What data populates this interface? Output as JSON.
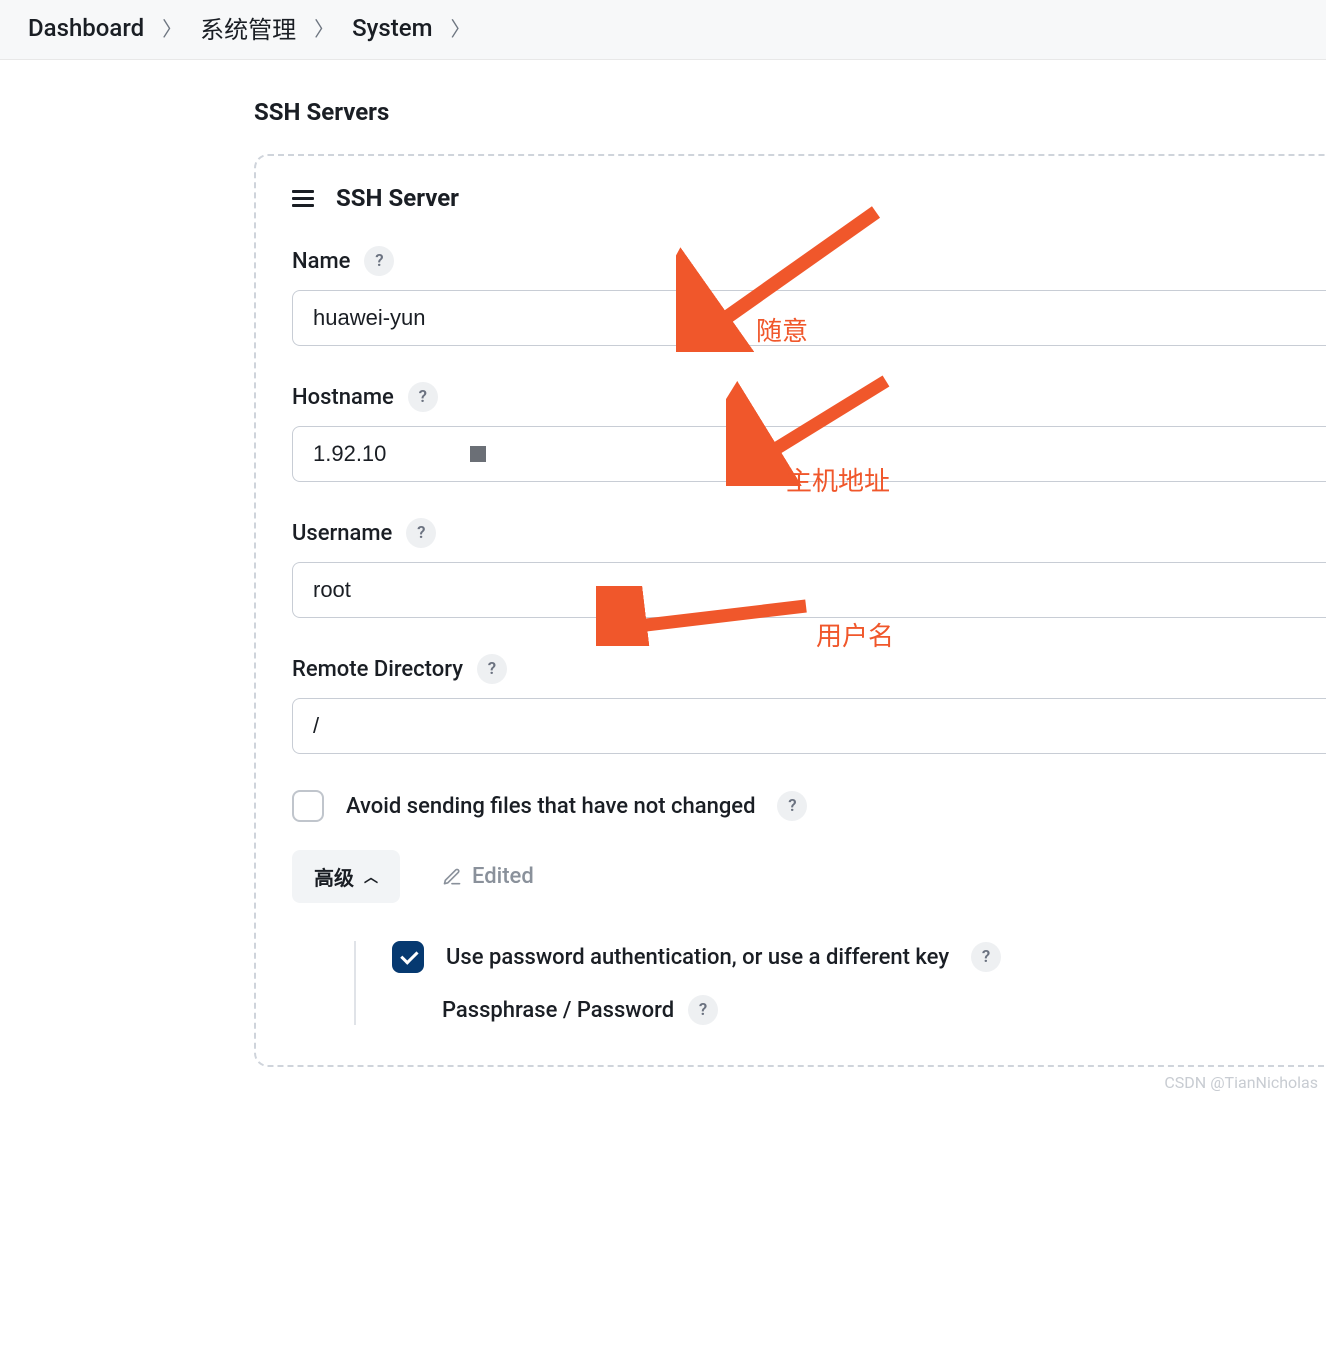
{
  "breadcrumb": {
    "items": [
      "Dashboard",
      "系统管理",
      "System"
    ]
  },
  "page": {
    "title": "SSH Servers"
  },
  "section": {
    "title": "SSH Server"
  },
  "fields": {
    "name": {
      "label": "Name",
      "value": "huawei-yun"
    },
    "hostname": {
      "label": "Hostname",
      "value": "1.92.10"
    },
    "username": {
      "label": "Username",
      "value": "root"
    },
    "remote_dir": {
      "label": "Remote Directory",
      "value": "/"
    },
    "avoid_unchanged": {
      "label": "Avoid sending files that have not changed",
      "checked": false
    },
    "advanced": {
      "label": "高级",
      "edited": "Edited"
    },
    "use_password": {
      "label": "Use password authentication, or use a different key",
      "checked": true
    },
    "passphrase": {
      "label": "Passphrase / Password"
    }
  },
  "annotations": {
    "name": "随意",
    "hostname": "主机地址",
    "username": "用户名"
  },
  "watermark": "CSDN @TianNicholas"
}
